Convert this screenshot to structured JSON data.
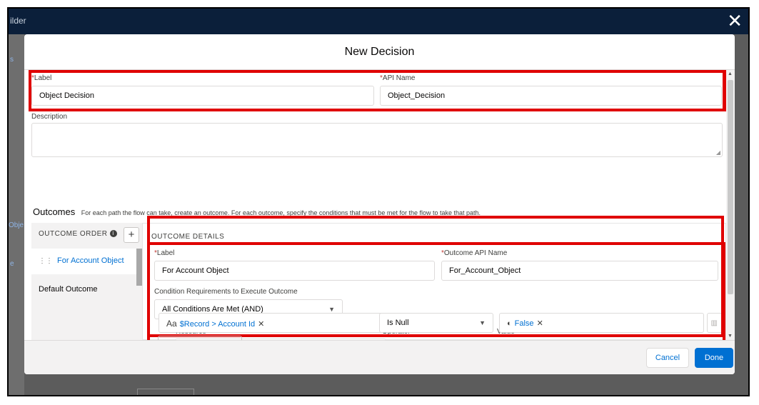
{
  "window": {
    "title": "ilder",
    "close_glyph": "✕"
  },
  "background": {
    "bits": [
      "s",
      "Obje",
      "e"
    ]
  },
  "modal": {
    "title": "New Decision",
    "label": {
      "text": "Label",
      "value": "Object Decision"
    },
    "api_name": {
      "text": "API Name",
      "value": "Object_Decision"
    },
    "description": {
      "text": "Description",
      "value": ""
    },
    "outcomes": {
      "title": "Outcomes",
      "description": "For each path the flow can take, create an outcome. For each outcome, specify the conditions that must be met for the flow to take that path."
    },
    "outcome_order": {
      "title": "OUTCOME ORDER",
      "add_glyph": "+",
      "items": [
        {
          "label": "For Account Object",
          "active": true
        },
        {
          "label": "Default Outcome",
          "active": false
        }
      ]
    },
    "outcome_details": {
      "title": "OUTCOME DETAILS",
      "label": {
        "text": "Label",
        "value": "For Account Object"
      },
      "api_name": {
        "text": "Outcome API Name",
        "value": "For_Account_Object"
      },
      "condition_requirements": {
        "text": "Condition Requirements to Execute Outcome",
        "value": "All Conditions Are Met (AND)"
      },
      "condition": {
        "resource_header": "Resource",
        "operator_header": "Operator",
        "value_header": "Value",
        "resource_icon": "Aa",
        "resource_value": "$Record > Account Id",
        "operator_value": "Is Null",
        "value_icon": "boolean-icon",
        "value_value": "False"
      }
    },
    "footer": {
      "cancel_label": "Cancel",
      "done_label": "Done"
    }
  },
  "colors": {
    "brand": "#0070d2",
    "highlight": "#e00000",
    "header_bg": "#0b1f3a"
  }
}
